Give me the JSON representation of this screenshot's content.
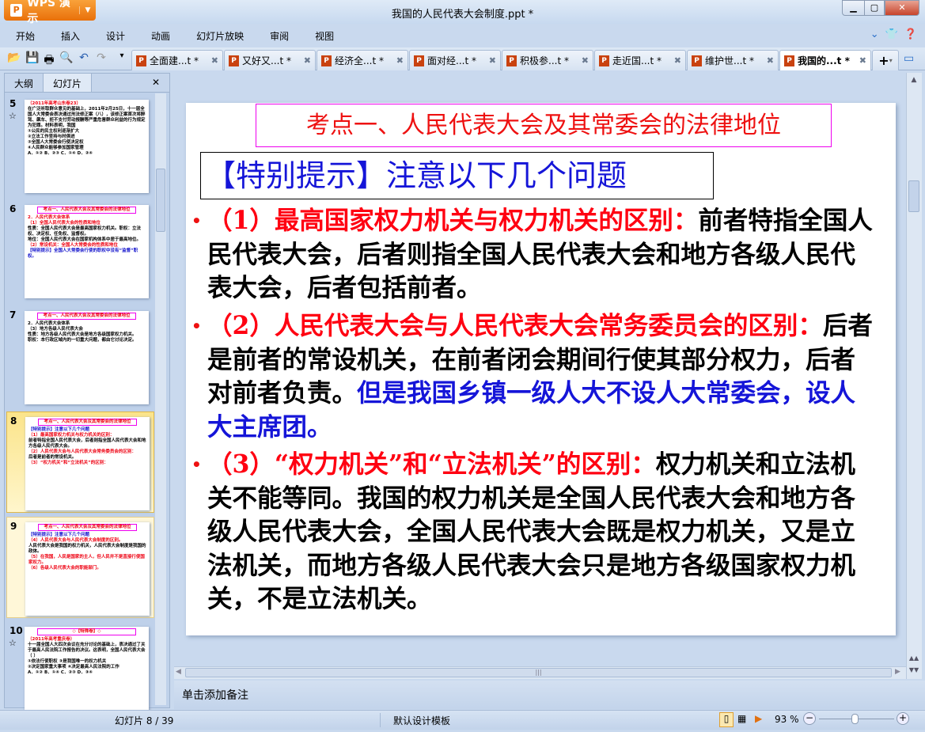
{
  "app": {
    "name": "WPS 演示",
    "title": "我国的人民代表大会制度.ppt *"
  },
  "menu": [
    "开始",
    "插入",
    "设计",
    "动画",
    "幻灯片放映",
    "审阅",
    "视图"
  ],
  "doc_tabs": [
    "全面建...t *",
    "又好又...t *",
    "经济全...t *",
    "面对经...t *",
    "积极参...t *",
    "走近国...t *",
    "维护世...t *",
    "我国的...t *"
  ],
  "left_panel": {
    "tabs": [
      "大纲",
      "幻灯片"
    ]
  },
  "thumbnails": [
    {
      "num": "5",
      "lines": [
        {
          "c": "r",
          "t": "（2011年高考山东卷23）"
        },
        {
          "c": "",
          "t": "在广泛听取群众意见的基础上，2011年2月25日，十一届全国人大常委会表决通过刑法修正案（八），该修正案首次将醉驾、飙车、拒不支付劳动报酬等严重危害群众利益的行为规定为犯罪。材料表明，我国"
        },
        {
          "c": "",
          "t": "①公民的民主权利逐渐扩大"
        },
        {
          "c": "",
          "t": "②立法工作坚持与时俱进"
        },
        {
          "c": "",
          "t": "③全国人大常委会行使决定权"
        },
        {
          "c": "",
          "t": "④人民群众能够参加国家管理"
        },
        {
          "c": "",
          "t": "A．①②  B．②③  C．①④  D．②④"
        }
      ]
    },
    {
      "num": "6",
      "title": "考点一、人民代表大会及其常委会的法律地位",
      "lines": [
        {
          "c": "r",
          "t": "2．人民代表大会体系"
        },
        {
          "c": "r",
          "t": "（1）全国人民代表大会的性质和地位"
        },
        {
          "c": "",
          "t": "性质：全国人民代表大会是最高国家权力机关。职权：立法权、决定权、任免权、监督权。"
        },
        {
          "c": "",
          "t": "地位：全国人民代表大会在国家机构体系中居于最高地位。"
        },
        {
          "c": "r",
          "t": "（2）常设机关：全国人大常委会的性质和地位"
        },
        {
          "c": "b",
          "t": "【特别提示】全国人大常委会行使的职权中没有“监督”职权。"
        }
      ]
    },
    {
      "num": "7",
      "title": "考点一、人民代表大会及其常委会的法律地位",
      "lines": [
        {
          "c": "",
          "t": "2．人民代表大会体系"
        },
        {
          "c": "",
          "t": "（3）地方各级人民代表大会"
        },
        {
          "c": "",
          "t": "性质：地方各级人民代表大会是地方各级国家权力机关。"
        },
        {
          "c": "",
          "t": "职权：本行政区域内的一切重大问题，都由它讨论决定。"
        }
      ]
    },
    {
      "num": "8",
      "title": "考点一、人民代表大会及其常委会的法律地位",
      "lines": [
        {
          "c": "b",
          "t": "【特别提示】注意以下几个问题"
        },
        {
          "c": "r",
          "t": "（1）最高国家权力机关与权力机关的区别："
        },
        {
          "c": "",
          "t": "前者特指全国人民代表大会，后者则指全国人民代表大会和地方各级人民代表大会。"
        },
        {
          "c": "r",
          "t": "（2）人民代表大会与人民代表大会常务委员会的区别："
        },
        {
          "c": "",
          "t": "后者是前者的常设机关。"
        },
        {
          "c": "r",
          "t": "（3）“权力机关”和“立法机关”的区别："
        }
      ]
    },
    {
      "num": "9",
      "title": "考点一、人民代表大会及其常委会的法律地位",
      "lines": [
        {
          "c": "b",
          "t": "【特别提示】注意以下几个问题"
        },
        {
          "c": "r",
          "t": "（4）人民代表大会与人民代表大会制度的区别。"
        },
        {
          "c": "",
          "t": "人民代表大会是我国的权力机关，人民代表大会制度是我国的政体。"
        },
        {
          "c": "r",
          "t": "（5）在我国，人民是国家的主人，但人民并不是直接行使国家权力。"
        },
        {
          "c": "r",
          "t": "（6）各级人民代表大会的职能部门。"
        }
      ]
    },
    {
      "num": "10",
      "title": "◇【特殊卷】◇",
      "lines": [
        {
          "c": "r",
          "t": "（2011年高考重庆卷）"
        },
        {
          "c": "",
          "t": "十一届全国人大四次会议在充分讨论的基础上，表决通过了关于最高人民法院工作报告的决议。这表明，全国人民代表大会（ ）"
        },
        {
          "c": "",
          "t": "①依法行使职权  ③是我国唯一的权力机关"
        },
        {
          "c": "",
          "t": "②决定国家重大事项  ④决定最高人民法院的工作"
        },
        {
          "c": "",
          "t": "A．①②  B．①④  C．②③  D．③④"
        }
      ]
    }
  ],
  "slide": {
    "title": "考点一、人民代表大会及其常委会的法律地位",
    "tip": "【特别提示】注意以下几个问题",
    "p1": {
      "head": "（1）最高国家权力机关与权力机关的区别：",
      "body": "前者特指全国人民代表大会，后者则指全国人民代表大会和地方各级人民代表大会，后者包括前者。"
    },
    "p2": {
      "head": "（2）人民代表大会与人民代表大会常务委员会的区别：",
      "body": "后者是前者的常设机关，在前者闭会期间行使其部分权力，后者对前者负责。",
      "blue": "但是我国乡镇一级人大不设人大常委会，设人大主席团。"
    },
    "p3": {
      "head": "（3）“权力机关”和“立法机关”的区别：",
      "body": "权力机关和立法机关不能等同。我国的权力机关是全国人民代表大会和地方各级人民代表大会，全国人民代表大会既是权力机关，又是立法机关，而地方各级人民代表大会只是地方各级国家权力机关，不是立法机关。"
    }
  },
  "notes_placeholder": "单击添加备注",
  "status": {
    "slide_counter": "幻灯片 8 / 39",
    "template": "默认设计模板",
    "zoom": "93 %",
    "zoom_level_percent": 93
  }
}
